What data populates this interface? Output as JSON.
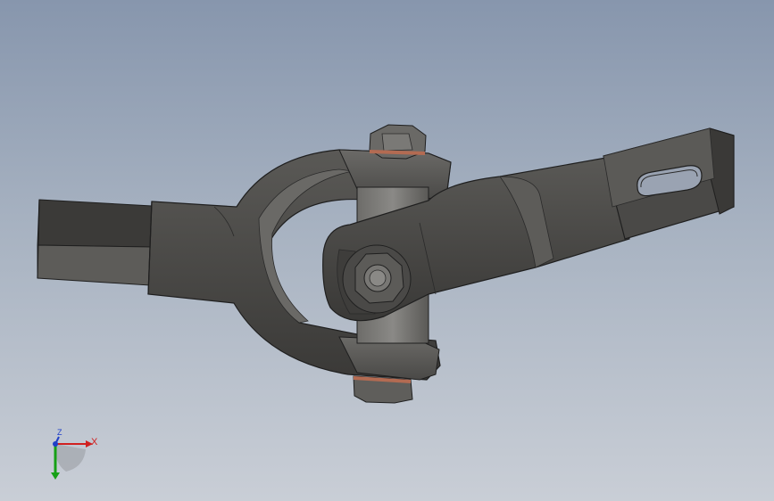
{
  "viewport": {
    "background_top": "#8796ad",
    "background_bottom": "#c9ced6"
  },
  "model": {
    "name_icon": "universal-joint",
    "part_color": "#4b4a48",
    "edge_color": "#1f1f1f"
  },
  "triad": {
    "x_label": "X",
    "y_label": "",
    "z_label": "Z",
    "x_color": "#d02020",
    "y_color": "#16a016",
    "z_color": "#1f3fc8"
  }
}
